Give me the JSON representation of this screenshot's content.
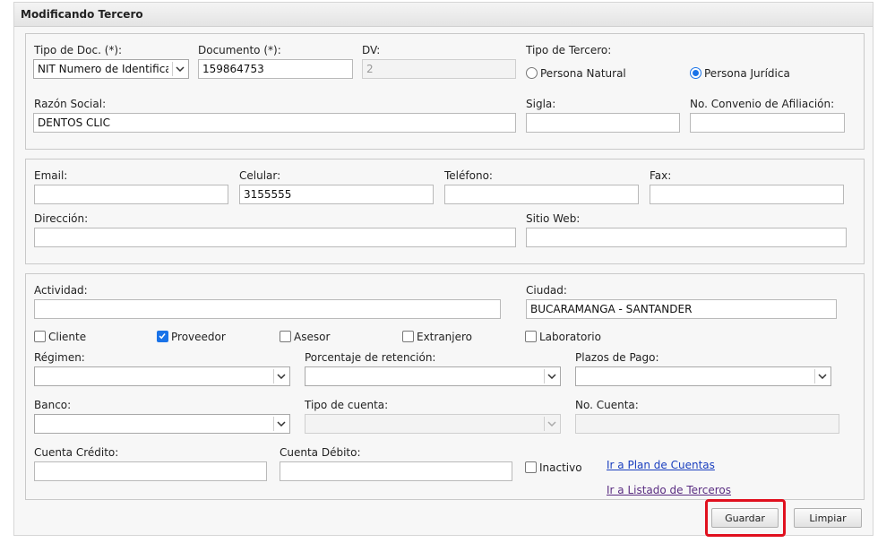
{
  "panel": {
    "title": "Modificando Tercero"
  },
  "identificacion": {
    "tipo_doc_label": "Tipo de Doc. (*):",
    "tipo_doc_value": "NIT Numero de Identificacion",
    "documento_label": "Documento (*):",
    "documento_value": "159864753",
    "dv_label": "DV:",
    "dv_value": "2",
    "tipo_tercero_label": "Tipo de Tercero:",
    "persona_natural_label": "Persona Natural",
    "persona_juridica_label": "Persona Jurídica",
    "selected_tipo_tercero": "Persona Jurídica",
    "razon_social_label": "Razón Social:",
    "razon_social_value": "DENTOS CLIC",
    "sigla_label": "Sigla:",
    "sigla_value": "",
    "convenio_label": "No. Convenio de Afiliación:",
    "convenio_value": ""
  },
  "contacto": {
    "email_label": "Email:",
    "email_value": "",
    "celular_label": "Celular:",
    "celular_value": "3155555",
    "telefono_label": "Teléfono:",
    "telefono_value": "",
    "fax_label": "Fax:",
    "fax_value": "",
    "direccion_label": "Dirección:",
    "direccion_value": "",
    "sitio_web_label": "Sitio Web:",
    "sitio_web_value": ""
  },
  "detalle": {
    "actividad_label": "Actividad:",
    "actividad_value": "",
    "ciudad_label": "Ciudad:",
    "ciudad_value": "BUCARAMANGA - SANTANDER",
    "checkboxes": [
      {
        "label": "Cliente",
        "checked": false
      },
      {
        "label": "Proveedor",
        "checked": true
      },
      {
        "label": "Asesor",
        "checked": false
      },
      {
        "label": "Extranjero",
        "checked": false
      },
      {
        "label": "Laboratorio",
        "checked": false
      }
    ],
    "regimen_label": "Régimen:",
    "regimen_value": "",
    "retencion_label": "Porcentaje de retención:",
    "retencion_value": "",
    "plazos_label": "Plazos de Pago:",
    "plazos_value": "",
    "banco_label": "Banco:",
    "banco_value": "",
    "tipo_cuenta_label": "Tipo de cuenta:",
    "tipo_cuenta_value": "",
    "no_cuenta_label": "No. Cuenta:",
    "no_cuenta_value": "",
    "cuenta_credito_label": "Cuenta Crédito:",
    "cuenta_credito_value": "",
    "cuenta_debito_label": "Cuenta Débito:",
    "cuenta_debito_value": "",
    "inactivo_label": "Inactivo",
    "inactivo_checked": false,
    "link_plan": "Ir a Plan de Cuentas",
    "link_listado": "Ir a Listado de Terceros"
  },
  "actions": {
    "guardar": "Guardar",
    "limpiar": "Limpiar"
  },
  "colors": {
    "accent": "#1a73e8",
    "highlight": "#e0101e",
    "link": "#1a3fbf",
    "visited": "#5a2d82"
  },
  "icons": {
    "dropdown": "chevron-down-icon",
    "check": "checkmark-icon"
  }
}
